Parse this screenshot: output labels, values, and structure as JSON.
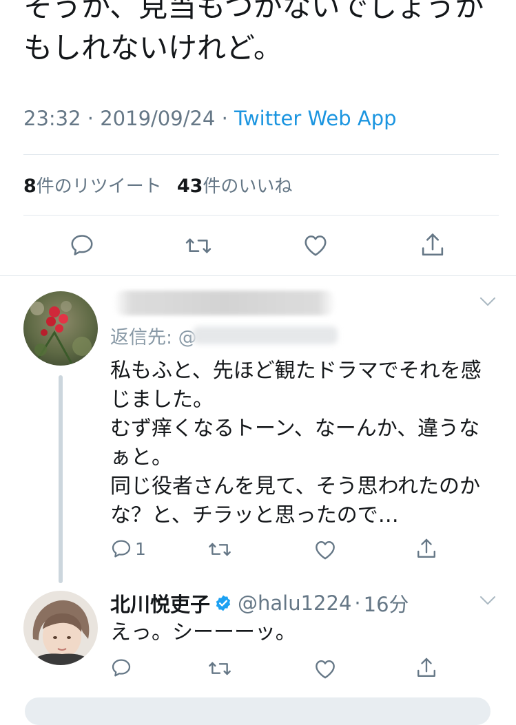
{
  "tweet": {
    "text_lines": [
      "そうか、見当もつかないでしょうか",
      "もしれないけれど。"
    ],
    "time": "23:32",
    "date": "2019/09/24",
    "separator": "·",
    "source": "Twitter Web App",
    "retweet_count": "8",
    "retweet_label": "件のリツイート",
    "like_count": "43",
    "like_label": "件のいいね"
  },
  "reply1": {
    "reply_to_prefix": "返信先: @",
    "text_lines": [
      "私もふと、先ほど観たドラマでそれを感",
      "じました。",
      "むず痒くなるトーン、なーんか、違うな",
      "ぁと。",
      "同じ役者さんを見て、そう思われたのか",
      "な？と、チラッと思ったので…"
    ],
    "reply_count": "1"
  },
  "reply2": {
    "name": "北川悦吏子",
    "handle": "@halu1224",
    "age": "16分",
    "text": "えっ。シーーーッ。"
  },
  "icons": {
    "reply": "speech-bubble-icon",
    "retweet": "retweet-arrows-icon",
    "like": "heart-icon",
    "share": "share-upload-icon",
    "more": "chevron-down-icon",
    "verified": "verified-badge-icon"
  },
  "colors": {
    "link": "#1b95e0",
    "secondary_text": "#657786",
    "verified": "#1da1f2",
    "divider": "#e1e8ed"
  }
}
